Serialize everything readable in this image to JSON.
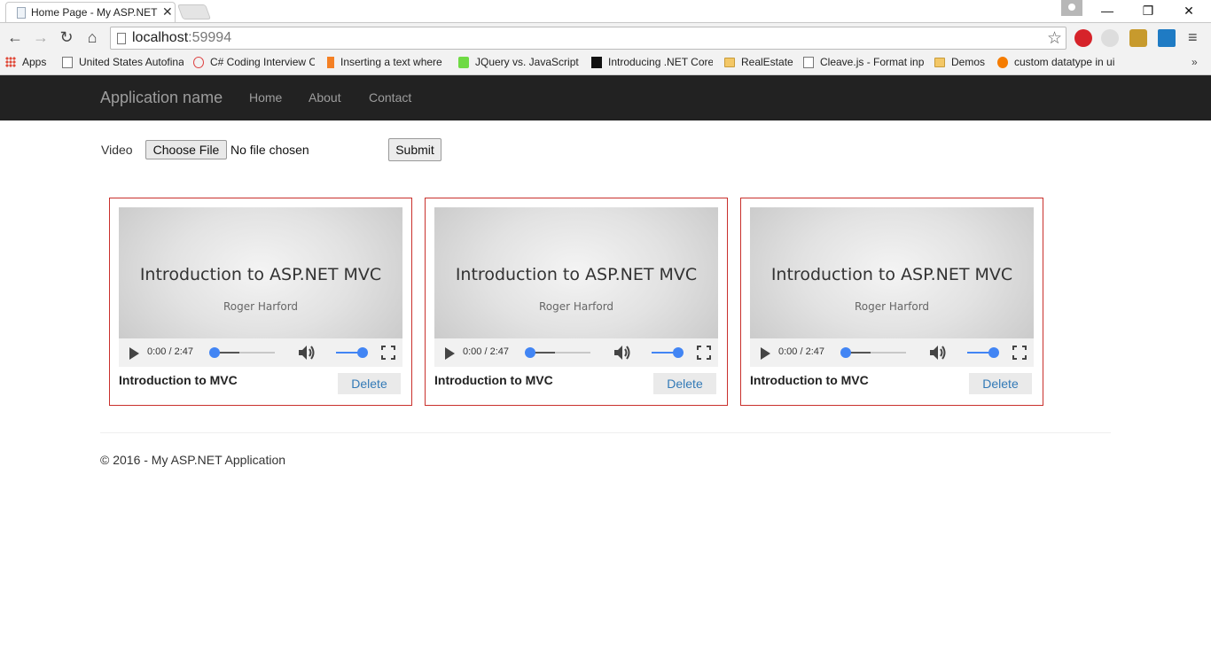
{
  "browser": {
    "tab_title": "Home Page - My ASP.NET",
    "tab_close": "✕",
    "window_controls": {
      "minimize": "—",
      "restore": "❐",
      "close": "✕"
    },
    "url_host": "localhost",
    "url_port": ":59994",
    "bookmarks": [
      {
        "label": "Apps",
        "icon": "apps-icon"
      },
      {
        "label": "United States Autofina",
        "icon": "page-icon"
      },
      {
        "label": "C# Coding Interview C",
        "icon": "page-icon"
      },
      {
        "label": "Inserting a text where",
        "icon": "stackoverflow-icon"
      },
      {
        "label": "JQuery vs. JavaScript:",
        "icon": "upwork-icon"
      },
      {
        "label": "Introducing .NET Core",
        "icon": "medium-icon"
      },
      {
        "label": "RealEstate",
        "icon": "folder-icon"
      },
      {
        "label": "Cleave.js - Format inpu",
        "icon": "page-icon"
      },
      {
        "label": "Demos",
        "icon": "folder-icon"
      },
      {
        "label": "custom datatype in ui",
        "icon": "heart-icon"
      }
    ],
    "bookmarks_more": "»"
  },
  "navbar": {
    "brand": "Application name",
    "links": [
      "Home",
      "About",
      "Contact"
    ]
  },
  "upload": {
    "label": "Video",
    "choose_file": "Choose File",
    "status": "No file chosen",
    "submit": "Submit"
  },
  "videos": [
    {
      "slide_title": "Introduction to ASP.NET MVC",
      "slide_author": "Roger Harford",
      "time": "0:00 / 2:47",
      "caption": "Introduction to MVC",
      "delete": "Delete",
      "buffered_fraction": 0.45,
      "volume_fraction": 1.0
    },
    {
      "slide_title": "Introduction to ASP.NET MVC",
      "slide_author": "Roger Harford",
      "time": "0:00 / 2:47",
      "caption": "Introduction to MVC",
      "delete": "Delete",
      "buffered_fraction": 0.45,
      "volume_fraction": 1.0
    },
    {
      "slide_title": "Introduction to ASP.NET MVC",
      "slide_author": "Roger Harford",
      "time": "0:00 / 2:47",
      "caption": "Introduction to MVC",
      "delete": "Delete",
      "buffered_fraction": 0.45,
      "volume_fraction": 1.0
    }
  ],
  "footer": {
    "text": "© 2016 - My ASP.NET Application"
  },
  "colors": {
    "navbar_bg": "#222222",
    "card_border": "#c9302c",
    "link": "#337ab7",
    "media_accent": "#4285f4"
  }
}
